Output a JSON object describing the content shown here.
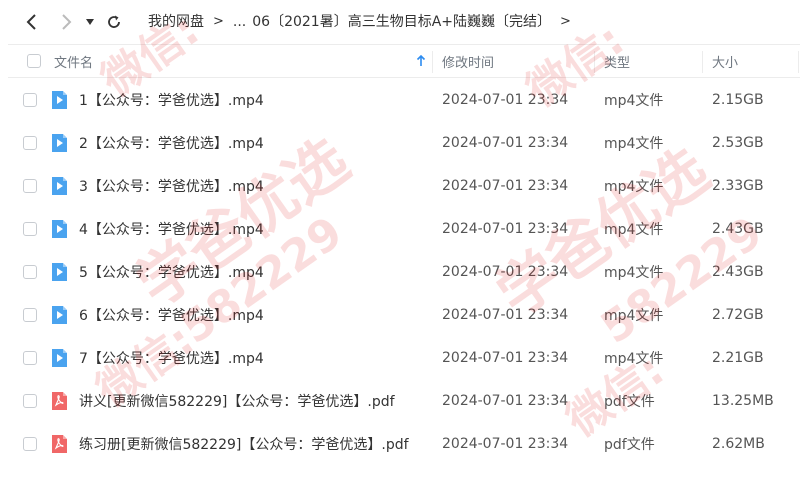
{
  "nav": {
    "breadcrumbs": [
      "我的网盘",
      "...",
      "06〔2021暑〕高三生物目标A+陆巍巍〔完结〕"
    ]
  },
  "columns": {
    "name": "文件名",
    "modified": "修改时间",
    "type": "类型",
    "size": "大小"
  },
  "files": [
    {
      "name": "1【公众号：学爸优选】.mp4",
      "modified": "2024-07-01 23:34",
      "type": "mp4文件",
      "size": "2.15GB",
      "icon": "video-file-icon"
    },
    {
      "name": "2【公众号：学爸优选】.mp4",
      "modified": "2024-07-01 23:34",
      "type": "mp4文件",
      "size": "2.53GB",
      "icon": "video-file-icon"
    },
    {
      "name": "3【公众号：学爸优选】.mp4",
      "modified": "2024-07-01 23:34",
      "type": "mp4文件",
      "size": "2.33GB",
      "icon": "video-file-icon"
    },
    {
      "name": "4【公众号：学爸优选】.mp4",
      "modified": "2024-07-01 23:34",
      "type": "mp4文件",
      "size": "2.43GB",
      "icon": "video-file-icon"
    },
    {
      "name": "5【公众号：学爸优选】.mp4",
      "modified": "2024-07-01 23:34",
      "type": "mp4文件",
      "size": "2.43GB",
      "icon": "video-file-icon"
    },
    {
      "name": "6【公众号：学爸优选】.mp4",
      "modified": "2024-07-01 23:34",
      "type": "mp4文件",
      "size": "2.72GB",
      "icon": "video-file-icon"
    },
    {
      "name": "7【公众号：学爸优选】.mp4",
      "modified": "2024-07-01 23:34",
      "type": "mp4文件",
      "size": "2.21GB",
      "icon": "video-file-icon"
    },
    {
      "name": "讲义[更新微信582229]【公众号：学爸优选】.pdf",
      "modified": "2024-07-01 23:34",
      "type": "pdf文件",
      "size": "13.25MB",
      "icon": "pdf-file-icon"
    },
    {
      "name": "练习册[更新微信582229]【公众号：学爸优选】.pdf",
      "modified": "2024-07-01 23:34",
      "type": "pdf文件",
      "size": "2.62MB",
      "icon": "pdf-file-icon"
    }
  ],
  "watermark": {
    "line1": "学爸优选",
    "line2": "582229",
    "line3": "微信:"
  },
  "colors": {
    "video_icon": "#4aa3ef",
    "pdf_icon": "#f06767",
    "sort_arrow": "#2d8cf0",
    "watermark": "#dd2222"
  }
}
